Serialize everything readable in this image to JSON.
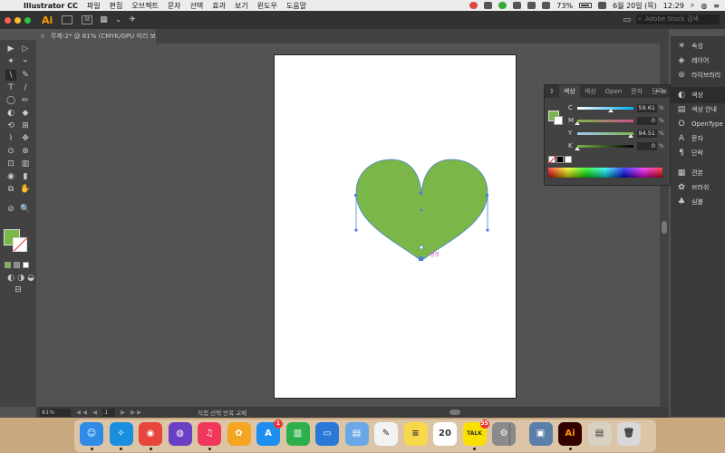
{
  "menubar": {
    "app_name": "Illustrator CC",
    "items": [
      "파일",
      "편집",
      "오브젝트",
      "문자",
      "선택",
      "효과",
      "보기",
      "윈도우",
      "도움말"
    ],
    "battery": "73%",
    "date": "6월 20일 (목)",
    "time": "12:29"
  },
  "appbar": {
    "logo": "Ai",
    "st_label": "St",
    "search_placeholder": "Adobe Stock 검색"
  },
  "document": {
    "tab_title": "무제-2* @ 81% (CMYK/GPU 미리 보기)",
    "close": "×"
  },
  "tools": [
    "▶",
    "▷",
    "✦",
    "⌁",
    "\\",
    "✎",
    "T",
    "/",
    "◯",
    "✏",
    "◐",
    "◆",
    "⟲",
    "⊞",
    "⌇",
    "✥",
    "⊙",
    "⊕",
    "⊡",
    "▥",
    "◉",
    "▮",
    "⧉",
    "✋",
    "⊘",
    "🔍"
  ],
  "color_panel": {
    "tabs": [
      "색상",
      "색상",
      "Open",
      "문자",
      "단락"
    ],
    "more": "»",
    "menu": "≡",
    "channels": [
      {
        "name": "C",
        "value": "59.61",
        "pos": 0.5961,
        "gradient": "linear-gradient(to right,#fff,#00aeef)"
      },
      {
        "name": "M",
        "value": "0",
        "pos": 0.0,
        "gradient": "linear-gradient(to right,#7ab648,#d05090)"
      },
      {
        "name": "Y",
        "value": "94.51",
        "pos": 0.9451,
        "gradient": "linear-gradient(to right,#9ec9f0,#7ab648)"
      },
      {
        "name": "K",
        "value": "0",
        "pos": 0.0,
        "gradient": "linear-gradient(to right,#7ab648,#000)"
      }
    ],
    "pct": "%"
  },
  "right_panels": [
    {
      "icon": "☀",
      "label": "속성"
    },
    {
      "icon": "◈",
      "label": "레이어"
    },
    {
      "icon": "⊚",
      "label": "라이브러리"
    },
    {
      "icon": "◐",
      "label": "색상",
      "active": true
    },
    {
      "icon": "▤",
      "label": "색상 안내"
    },
    {
      "icon": "O",
      "label": "OpenType"
    },
    {
      "icon": "A",
      "label": "문자"
    },
    {
      "icon": "¶",
      "label": "단락"
    },
    {
      "icon": "▦",
      "label": "견본"
    },
    {
      "icon": "✿",
      "label": "브러쉬"
    },
    {
      "icon": "♣",
      "label": "심볼"
    }
  ],
  "canvas": {
    "heart_color": "#7ab648",
    "path_color": "#4a7fd8",
    "anchor_label": "경로"
  },
  "statusbar": {
    "zoom": "81%",
    "nav_prev": "◀◀ ◀",
    "page": "1",
    "nav_next": "▶ ▶▶",
    "mode": "직접 선택 반복 교체"
  },
  "dock": [
    {
      "name": "finder",
      "glyph": "☺",
      "color": "#2f8be6"
    },
    {
      "name": "safari",
      "glyph": "✧",
      "color": "#1a8fe0"
    },
    {
      "name": "chrome",
      "glyph": "◉",
      "color": "#e8453c"
    },
    {
      "name": "siri",
      "glyph": "◍",
      "color": "#6b3fc4"
    },
    {
      "name": "music",
      "glyph": "♫",
      "color": "#f2385a"
    },
    {
      "name": "photos",
      "glyph": "✿",
      "color": "#f4a623"
    },
    {
      "name": "app-store",
      "glyph": "A",
      "color": "#1d8ff2",
      "badge": "1"
    },
    {
      "name": "numbers",
      "glyph": "▥",
      "color": "#2db04b"
    },
    {
      "name": "keynote",
      "glyph": "▭",
      "color": "#2a78d8"
    },
    {
      "name": "preview",
      "glyph": "▤",
      "color": "#6aa7e6"
    },
    {
      "name": "textedit",
      "glyph": "✎",
      "color": "#f2f2f2"
    },
    {
      "name": "notes",
      "glyph": "≡",
      "color": "#f7d84a"
    },
    {
      "name": "calendar",
      "glyph": "20",
      "color": "#ffffff"
    },
    {
      "name": "kakaotalk",
      "glyph": "TALK",
      "color": "#f9e000",
      "badge": "35"
    },
    {
      "name": "system-preferences",
      "glyph": "⚙",
      "color": "#8a8a8a"
    },
    {
      "name": "image-capture",
      "glyph": "▣",
      "color": "#5a7fa8"
    },
    {
      "name": "illustrator",
      "glyph": "Ai",
      "color": "#330000"
    },
    {
      "name": "documents",
      "glyph": "▤",
      "color": "#d8d0c0"
    },
    {
      "name": "trash",
      "glyph": "🗑",
      "color": "#d8d8d8"
    }
  ]
}
